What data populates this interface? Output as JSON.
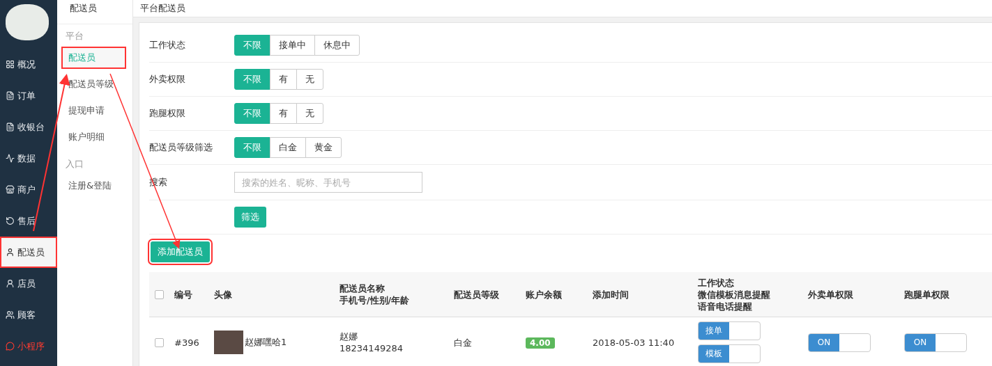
{
  "nav": {
    "items": [
      {
        "label": "概况",
        "selected": false,
        "highlighted": false,
        "alert": false
      },
      {
        "label": "订单",
        "selected": false,
        "highlighted": false,
        "alert": false
      },
      {
        "label": "收银台",
        "selected": false,
        "highlighted": false,
        "alert": false
      },
      {
        "label": "数据",
        "selected": false,
        "highlighted": false,
        "alert": false
      },
      {
        "label": "商户",
        "selected": false,
        "highlighted": false,
        "alert": false
      },
      {
        "label": "售后",
        "selected": false,
        "highlighted": false,
        "alert": false
      },
      {
        "label": "配送员",
        "selected": true,
        "highlighted": true,
        "alert": false
      },
      {
        "label": "店员",
        "selected": false,
        "highlighted": false,
        "alert": false
      },
      {
        "label": "顾客",
        "selected": false,
        "highlighted": false,
        "alert": false
      },
      {
        "label": "小程序",
        "selected": false,
        "highlighted": false,
        "alert": true
      }
    ]
  },
  "subnav": {
    "title": "配送员",
    "groups": [
      {
        "heading": "平台",
        "items": [
          {
            "label": "配送员",
            "selected": true,
            "highlighted": true
          },
          {
            "label": "配送员等级",
            "selected": false,
            "highlighted": false
          },
          {
            "label": "提现申请",
            "selected": false,
            "highlighted": false
          },
          {
            "label": "账户明细",
            "selected": false,
            "highlighted": false
          }
        ]
      },
      {
        "heading": "入口",
        "items": [
          {
            "label": "注册&登陆",
            "selected": false,
            "highlighted": false
          }
        ]
      }
    ]
  },
  "page": {
    "title": "平台配送员"
  },
  "filters": [
    {
      "label": "工作状态",
      "options": [
        {
          "label": "不限",
          "selected": true
        },
        {
          "label": "接单中",
          "selected": false
        },
        {
          "label": "休息中",
          "selected": false
        }
      ]
    },
    {
      "label": "外卖权限",
      "options": [
        {
          "label": "不限",
          "selected": true
        },
        {
          "label": "有",
          "selected": false
        },
        {
          "label": "无",
          "selected": false
        }
      ]
    },
    {
      "label": "跑腿权限",
      "options": [
        {
          "label": "不限",
          "selected": true
        },
        {
          "label": "有",
          "selected": false
        },
        {
          "label": "无",
          "selected": false
        }
      ]
    },
    {
      "label": "配送员等级筛选",
      "options": [
        {
          "label": "不限",
          "selected": true
        },
        {
          "label": "白金",
          "selected": false
        },
        {
          "label": "黄金",
          "selected": false
        }
      ]
    }
  ],
  "search": {
    "label": "搜索",
    "placeholder": "搜索的姓名、昵称、手机号"
  },
  "filter_button": "筛选",
  "add_button": {
    "label": "添加配送员",
    "highlighted": true
  },
  "table": {
    "select_all": {
      "checked": false
    },
    "columns": [
      [
        "编号"
      ],
      [
        "头像"
      ],
      [
        "配送员名称",
        "手机号/性别/年龄"
      ],
      [
        "配送员等级"
      ],
      [
        "账户余额"
      ],
      [
        "添加时间"
      ],
      [
        "工作状态",
        "微信模板消息提醒",
        "语音电话提醒"
      ],
      [
        "外卖单权限"
      ],
      [
        "跑腿单权限"
      ]
    ],
    "rows": [
      {
        "checked": false,
        "id": "#396",
        "nickname": "赵娜嘿哈1",
        "name": "赵娜",
        "phone": "18234149284",
        "level": "白金",
        "balance": "4.00",
        "time": "2018-05-03 11:40",
        "status_toggles": [
          {
            "label": "接单",
            "on": true
          },
          {
            "label": "模板",
            "on": true
          }
        ],
        "waimai": {
          "label": "ON",
          "on": true
        },
        "paotui": {
          "label": "ON",
          "on": true
        }
      }
    ]
  }
}
